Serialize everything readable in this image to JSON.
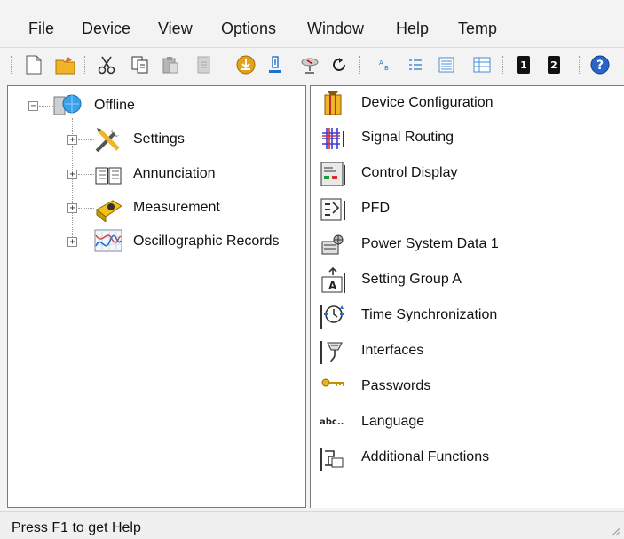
{
  "menu": [
    "File",
    "Device",
    "View",
    "Options",
    "Window",
    "Help",
    "Temp"
  ],
  "tree": {
    "root": {
      "label": "Offline",
      "expander": "−"
    },
    "children": [
      {
        "label": "Settings",
        "expander": "+"
      },
      {
        "label": "Annunciation",
        "expander": "+"
      },
      {
        "label": "Measurement",
        "expander": "+"
      },
      {
        "label": "Oscillographic Records",
        "expander": "+"
      }
    ]
  },
  "list": [
    {
      "label": "Device Configuration"
    },
    {
      "label": "Signal Routing"
    },
    {
      "label": "Control Display"
    },
    {
      "label": "PFD"
    },
    {
      "label": "Power System Data 1"
    },
    {
      "label": "Setting Group A"
    },
    {
      "label": "Time Synchronization"
    },
    {
      "label": "Interfaces"
    },
    {
      "label": "Passwords"
    },
    {
      "label": "Language",
      "icon_text": "abc.."
    },
    {
      "label": "Additional Functions"
    }
  ],
  "toolbar": {
    "badge_1": "1",
    "badge_2": "2",
    "help_glyph": "?"
  },
  "status": {
    "text": "Press F1 to get Help"
  },
  "colors": {
    "accent_blue": "#1f6fd1",
    "folder_yellow": "#f0b429",
    "panel_border": "#7a7a7a"
  }
}
